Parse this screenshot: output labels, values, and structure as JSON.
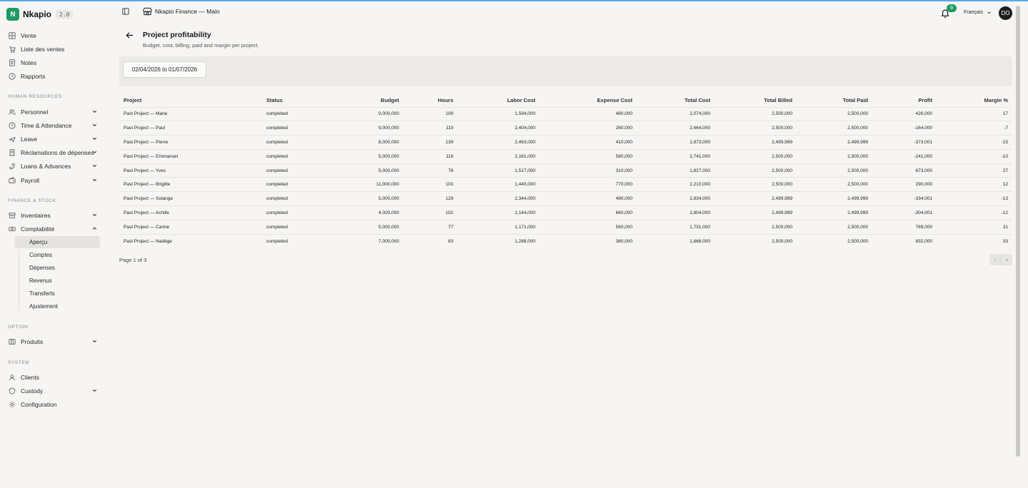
{
  "app": {
    "logo_letter": "N",
    "name": "Nkapio",
    "version": "2.0"
  },
  "header": {
    "store_name": "Nkapio Finance — Main",
    "notifications_count": "9",
    "language": "Français",
    "avatar_initials": "DO"
  },
  "sidebar": {
    "top_items": [
      {
        "label": "Vente",
        "icon": "grid-icon"
      },
      {
        "label": "Liste des ventes",
        "icon": "cart-icon"
      },
      {
        "label": "Notes",
        "icon": "note-icon"
      },
      {
        "label": "Rapports",
        "icon": "clock-icon"
      }
    ],
    "sections": {
      "hr": "HUMAN RESOURCES",
      "finance": "FINANCE & STOCK",
      "option": "OPTION",
      "system": "SYSTEM"
    },
    "hr_items": [
      {
        "label": "Personnel",
        "icon": "users-icon"
      },
      {
        "label": "Time & Attendance",
        "icon": "clock-icon"
      },
      {
        "label": "Leave",
        "icon": "plane-icon"
      },
      {
        "label": "Réclamations de dépenses",
        "icon": "receipt-icon"
      },
      {
        "label": "Loans & Advances",
        "icon": "hand-coins-icon"
      },
      {
        "label": "Payroll",
        "icon": "wallet-icon"
      }
    ],
    "finance_items": [
      {
        "label": "Inventaires",
        "icon": "box-icon"
      },
      {
        "label": "Comptabilité",
        "icon": "banknote-icon"
      }
    ],
    "accounting_sub": [
      "Aperçu",
      "Comptes",
      "Dépenses",
      "Revenus",
      "Transferts",
      "Ajustement"
    ],
    "option_items": [
      {
        "label": "Produits",
        "icon": "package-icon"
      }
    ],
    "system_items": [
      {
        "label": "Clients",
        "icon": "user-icon"
      },
      {
        "label": "Custody",
        "icon": "shield-icon"
      },
      {
        "label": "Configuration",
        "icon": "gear-icon"
      }
    ]
  },
  "page": {
    "title": "Project profitability",
    "subtitle": "Budget, cost, billing, paid and margin per project.",
    "date_range": "02/04/2026 to 01/07/2026",
    "pagination": "Page 1 of 3",
    "prev": "‹",
    "next": "›"
  },
  "table": {
    "columns": [
      "Project",
      "Status",
      "Budget",
      "Hours",
      "Labor Cost",
      "Expense Cost",
      "Total Cost",
      "Total Billed",
      "Total Paid",
      "Profit",
      "Margin %"
    ],
    "rows": [
      [
        "Past Project — Marie",
        "completed",
        "9,000,000",
        "109",
        "1,594,000",
        "480,000",
        "2,074,000",
        "2,500,000",
        "2,500,000",
        "426,000",
        "17"
      ],
      [
        "Past Project — Paul",
        "completed",
        "9,000,000",
        "119",
        "2,404,000",
        "260,000",
        "2,664,000",
        "2,500,000",
        "2,500,000",
        "-164,000",
        "-7"
      ],
      [
        "Past Project — Pierre",
        "completed",
        "8,000,000",
        "139",
        "2,463,000",
        "410,000",
        "2,873,000",
        "2,499,999",
        "2,499,999",
        "-373,001",
        "-15"
      ],
      [
        "Past Project — Emmanuel",
        "completed",
        "5,000,000",
        "118",
        "2,161,000",
        "580,000",
        "2,741,000",
        "2,500,000",
        "2,500,000",
        "-241,000",
        "-10"
      ],
      [
        "Past Project — Yves",
        "completed",
        "5,000,000",
        "78",
        "1,517,000",
        "310,000",
        "1,827,000",
        "2,500,000",
        "2,500,000",
        "673,000",
        "27"
      ],
      [
        "Past Project — Brigitte",
        "completed",
        "11,000,000",
        "103",
        "1,440,000",
        "770,000",
        "2,210,000",
        "2,500,000",
        "2,500,000",
        "290,000",
        "12"
      ],
      [
        "Past Project — Solange",
        "completed",
        "5,000,000",
        "129",
        "2,344,000",
        "490,000",
        "2,834,000",
        "2,499,999",
        "2,499,999",
        "-334,001",
        "-13"
      ],
      [
        "Past Project — Achille",
        "completed",
        "4,000,000",
        "102",
        "2,144,000",
        "660,000",
        "2,804,000",
        "2,499,999",
        "2,499,999",
        "-304,001",
        "-12"
      ],
      [
        "Past Project — Carine",
        "completed",
        "5,000,000",
        "77",
        "1,171,000",
        "560,000",
        "1,731,000",
        "2,500,000",
        "2,500,000",
        "769,000",
        "31"
      ],
      [
        "Past Project — Nadège",
        "completed",
        "7,000,000",
        "83",
        "1,288,000",
        "380,000",
        "1,668,000",
        "2,500,000",
        "2,500,000",
        "832,000",
        "33"
      ]
    ]
  },
  "colors": {
    "brand": "#1f9a63",
    "accent_line": "#5aa9e6",
    "background": "#f6f5f3"
  }
}
